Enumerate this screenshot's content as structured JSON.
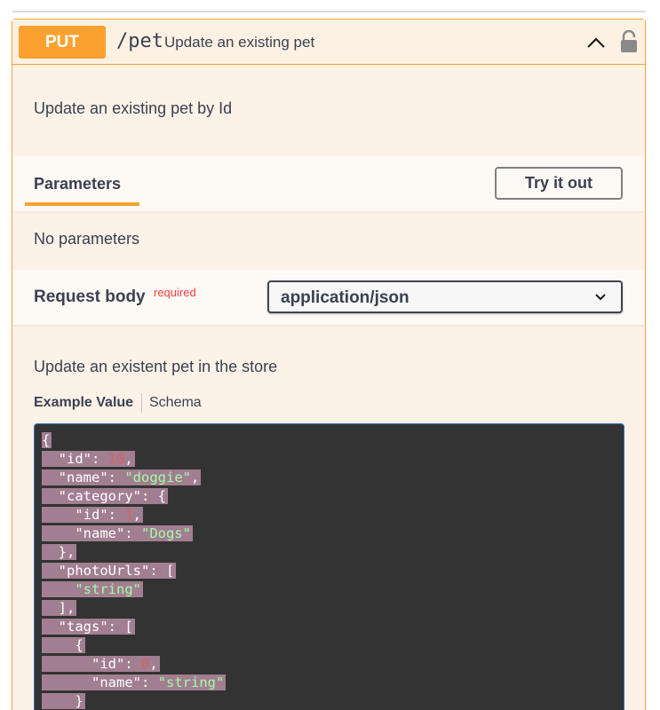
{
  "operation": {
    "method": "PUT",
    "path": "/pet",
    "summary": "Update an existing pet",
    "description": "Update an existing pet by Id"
  },
  "parameters": {
    "tab_label": "Parameters",
    "try_button": "Try it out",
    "empty_text": "No parameters"
  },
  "request_body": {
    "title": "Request body",
    "required_label": "required",
    "content_type": "application/json",
    "description": "Update an existent pet in the store",
    "tab_example": "Example Value",
    "tab_schema": "Schema"
  },
  "example_json": {
    "lines": [
      [
        {
          "t": "{",
          "c": ""
        }
      ],
      [
        {
          "t": "  \"id\": ",
          "c": ""
        },
        {
          "t": "10",
          "c": "num"
        },
        {
          "t": ",",
          "c": ""
        }
      ],
      [
        {
          "t": "  \"name\": ",
          "c": ""
        },
        {
          "t": "\"doggie\"",
          "c": "str"
        },
        {
          "t": ",",
          "c": ""
        }
      ],
      [
        {
          "t": "  \"category\": {",
          "c": ""
        }
      ],
      [
        {
          "t": "    \"id\": ",
          "c": ""
        },
        {
          "t": "1",
          "c": "num"
        },
        {
          "t": ",",
          "c": ""
        }
      ],
      [
        {
          "t": "    \"name\": ",
          "c": ""
        },
        {
          "t": "\"Dogs\"",
          "c": "str"
        }
      ],
      [
        {
          "t": "  },",
          "c": ""
        }
      ],
      [
        {
          "t": "  \"photoUrls\": [",
          "c": ""
        }
      ],
      [
        {
          "t": "    ",
          "c": ""
        },
        {
          "t": "\"string\"",
          "c": "str"
        }
      ],
      [
        {
          "t": "  ],",
          "c": ""
        }
      ],
      [
        {
          "t": "  \"tags\": [",
          "c": ""
        }
      ],
      [
        {
          "t": "    {",
          "c": ""
        }
      ],
      [
        {
          "t": "      \"id\": ",
          "c": ""
        },
        {
          "t": "0",
          "c": "num"
        },
        {
          "t": ",",
          "c": ""
        }
      ],
      [
        {
          "t": "      \"name\": ",
          "c": ""
        },
        {
          "t": "\"string\"",
          "c": "str"
        }
      ],
      [
        {
          "t": "    }",
          "c": ""
        }
      ]
    ]
  },
  "colors": {
    "method_put": "#fca130",
    "required": "#f93e3e",
    "code_bg": "#333333",
    "selection": "#a27e92",
    "json_string": "#a2fca2",
    "json_number": "#d36363"
  },
  "icons": {
    "collapse": "chevron-up-icon",
    "lock": "lock-icon",
    "dropdown": "chevron-down-icon"
  }
}
